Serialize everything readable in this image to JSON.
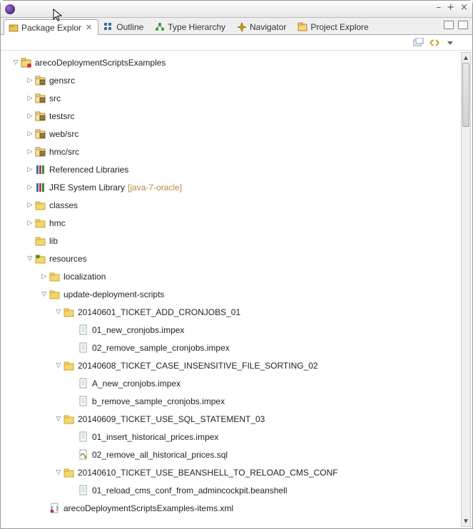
{
  "window": {
    "title": ""
  },
  "tabs": [
    {
      "label": "Package Explor",
      "active": true,
      "icon": "package-explorer"
    },
    {
      "label": "Outline",
      "active": false,
      "icon": "outline"
    },
    {
      "label": "Type Hierarchy",
      "active": false,
      "icon": "type-hierarchy"
    },
    {
      "label": "Navigator",
      "active": false,
      "icon": "navigator"
    },
    {
      "label": "Project Explore",
      "active": false,
      "icon": "project-explorer"
    }
  ],
  "tree": [
    {
      "d": 0,
      "exp": "open",
      "icon": "project",
      "label": "arecoDeploymentScriptsExamples"
    },
    {
      "d": 1,
      "exp": "closed",
      "icon": "package-folder",
      "label": "gensrc"
    },
    {
      "d": 1,
      "exp": "closed",
      "icon": "package-folder",
      "label": "src"
    },
    {
      "d": 1,
      "exp": "closed",
      "icon": "package-folder",
      "label": "testsrc"
    },
    {
      "d": 1,
      "exp": "closed",
      "icon": "package-folder",
      "label": "web/src"
    },
    {
      "d": 1,
      "exp": "closed",
      "icon": "package-folder",
      "label": "hmc/src"
    },
    {
      "d": 1,
      "exp": "closed",
      "icon": "library",
      "label": "Referenced Libraries"
    },
    {
      "d": 1,
      "exp": "closed",
      "icon": "library",
      "label": "JRE System Library",
      "suffix": "[java-7-oracle]"
    },
    {
      "d": 1,
      "exp": "closed",
      "icon": "folder",
      "label": "classes"
    },
    {
      "d": 1,
      "exp": "closed",
      "icon": "folder",
      "label": "hmc"
    },
    {
      "d": 1,
      "exp": "none",
      "icon": "folder",
      "label": "lib"
    },
    {
      "d": 1,
      "exp": "open",
      "icon": "folder-decorated",
      "label": "resources"
    },
    {
      "d": 2,
      "exp": "closed",
      "icon": "folder",
      "label": "localization"
    },
    {
      "d": 2,
      "exp": "open",
      "icon": "folder",
      "label": "update-deployment-scripts"
    },
    {
      "d": 3,
      "exp": "open",
      "icon": "folder",
      "label": "20140601_TICKET_ADD_CRONJOBS_01"
    },
    {
      "d": 4,
      "exp": "none",
      "icon": "file",
      "label": "01_new_cronjobs.impex"
    },
    {
      "d": 4,
      "exp": "none",
      "icon": "file",
      "label": "02_remove_sample_cronjobs.impex"
    },
    {
      "d": 3,
      "exp": "open",
      "icon": "folder",
      "label": "20140608_TICKET_CASE_INSENSITIVE_FILE_SORTING_02"
    },
    {
      "d": 4,
      "exp": "none",
      "icon": "file",
      "label": "A_new_cronjobs.impex"
    },
    {
      "d": 4,
      "exp": "none",
      "icon": "file",
      "label": "b_remove_sample_cronjobs.impex"
    },
    {
      "d": 3,
      "exp": "open",
      "icon": "folder",
      "label": "20140609_TICKET_USE_SQL_STATEMENT_03"
    },
    {
      "d": 4,
      "exp": "none",
      "icon": "file",
      "label": "01_insert_historical_prices.impex"
    },
    {
      "d": 4,
      "exp": "none",
      "icon": "file-sql",
      "label": "02_remove_all_historical_prices.sql"
    },
    {
      "d": 3,
      "exp": "open",
      "icon": "folder",
      "label": "20140610_TICKET_USE_BEANSHELL_TO_RELOAD_CMS_CONF"
    },
    {
      "d": 4,
      "exp": "none",
      "icon": "file",
      "label": "01_reload_cms_conf_from_admincockpit.beanshell"
    },
    {
      "d": 2,
      "exp": "none",
      "icon": "xml",
      "label": "arecoDeploymentScriptsExamples-items.xml"
    }
  ]
}
